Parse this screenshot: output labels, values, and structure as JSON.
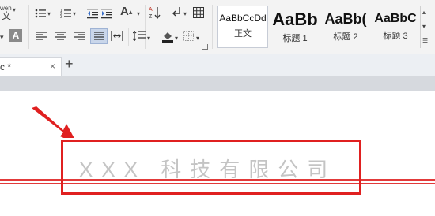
{
  "ribbon": {
    "phonetic_label": "wén",
    "phonetic_char": "文",
    "char_shading_label": "A",
    "styles": [
      {
        "sample": "AaBbCcDd",
        "name": "正文"
      },
      {
        "sample": "AaBb",
        "name": "标题 1"
      },
      {
        "sample": "AaBb(",
        "name": "标题 2"
      },
      {
        "sample": "AaBbC",
        "name": "标题 3"
      }
    ]
  },
  "tabs": {
    "document_tab": "c *",
    "close": "×",
    "new_tab": "+"
  },
  "document": {
    "company_text": "XXX 科技有限公司"
  },
  "colors": {
    "annotation_red": "#e02020",
    "header_line_red": "#e23a3a",
    "company_text_gray": "#c4c4c4"
  }
}
